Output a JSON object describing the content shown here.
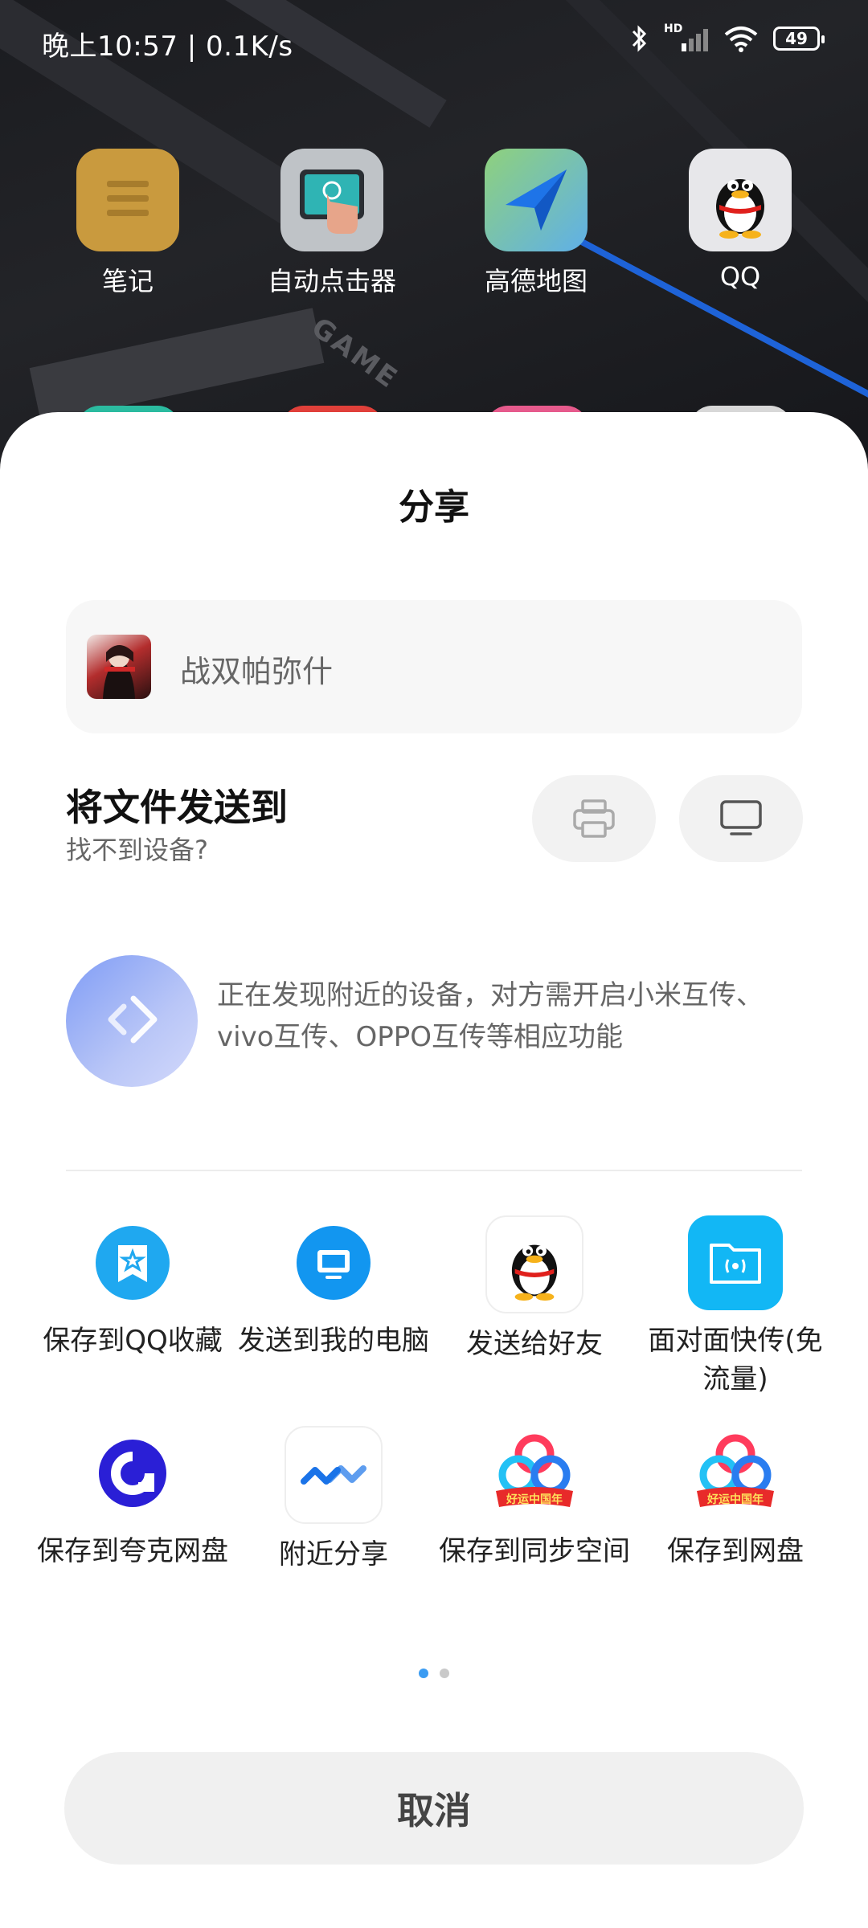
{
  "status_bar": {
    "time_speed": "晚上10:57 | 0.1K/s",
    "network": "HD",
    "battery": "49"
  },
  "home": {
    "apps": [
      {
        "label": "笔记",
        "icon": "note-icon"
      },
      {
        "label": "自动点击器",
        "icon": "auto-clicker-icon"
      },
      {
        "label": "高德地图",
        "icon": "gaode-map-icon"
      },
      {
        "label": "QQ",
        "icon": "qq-icon"
      }
    ],
    "wallpaper_text": "GAME"
  },
  "share_sheet": {
    "title": "分享",
    "file": {
      "name": "战双帕弥什",
      "thumbnail_icon": "game-thumbnail"
    },
    "send_to": {
      "title": "将文件发送到",
      "subtitle": "找不到设备?",
      "buttons": [
        {
          "icon": "printer-icon"
        },
        {
          "icon": "tv-icon"
        }
      ]
    },
    "discovery": {
      "icon": "transfer-icon",
      "text": "正在发现附近的设备，对方需开启小米互传、vivo互传、OPPO互传等相应功能"
    },
    "targets": [
      {
        "label": "保存到QQ收藏",
        "icon": "qq-favorites-icon",
        "color": "#1fa8f0"
      },
      {
        "label": "发送到我的电脑",
        "icon": "my-computer-icon",
        "color": "#1296f0"
      },
      {
        "label": "发送给好友",
        "icon": "qq-friend-icon",
        "color": "#000000"
      },
      {
        "label": "面对面快传(免流量)",
        "icon": "face-to-face-icon",
        "color": "#12b7f5"
      },
      {
        "label": "保存到夸克网盘",
        "icon": "quark-drive-icon",
        "color": "#2a1fd6"
      },
      {
        "label": "附近分享",
        "icon": "nearby-share-icon",
        "color": "#1a73e8"
      },
      {
        "label": "保存到同步空间",
        "icon": "baidu-sync-icon",
        "color": "#ff3b5c"
      },
      {
        "label": "保存到网盘",
        "icon": "baidu-netdisk-icon",
        "color": "#ff3b5c"
      }
    ],
    "badge_text": "好运中国年",
    "page_indicator": {
      "pages": 2,
      "current": 1
    },
    "cancel_label": "取消"
  },
  "colors": {
    "accent": "#3b9cf2",
    "sheet_bg": "#ffffff",
    "button_bg": "#f0f0f0"
  }
}
